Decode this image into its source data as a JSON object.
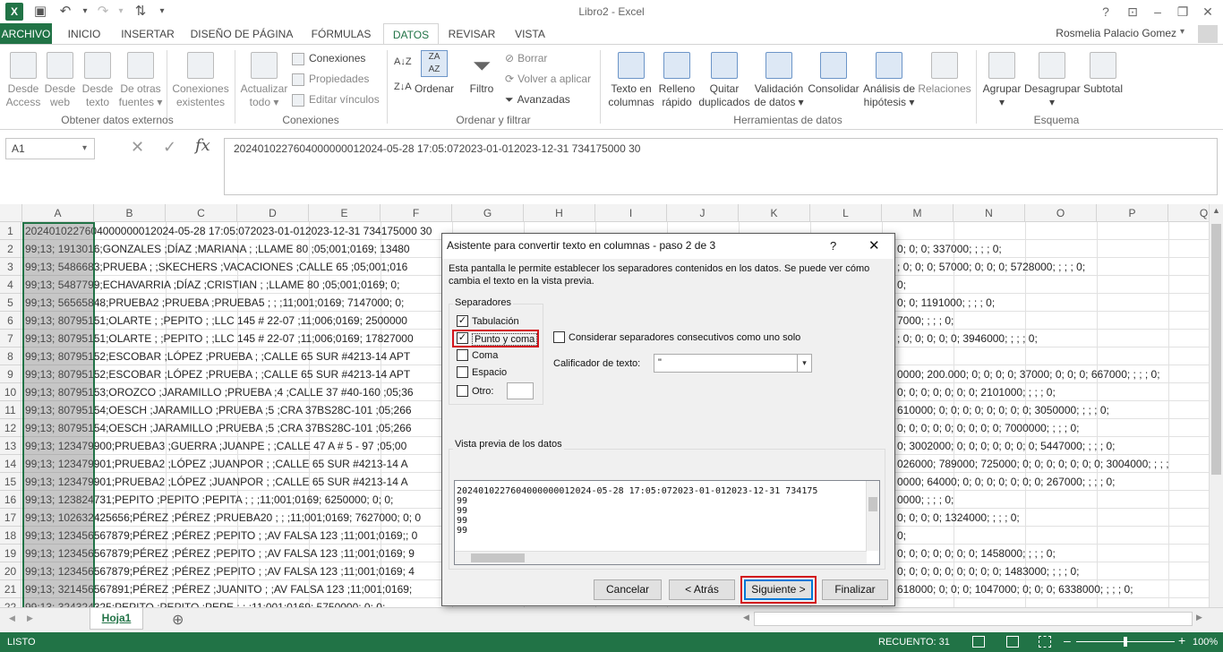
{
  "window": {
    "title": "Libro2 - Excel",
    "help": "?",
    "user": "Rosmelia Palacio Gomez",
    "sheet_tab": "Hoja1",
    "add_sheet": "⊕"
  },
  "tabs": [
    "ARCHIVO",
    "INICIO",
    "INSERTAR",
    "DISEÑO DE PÁGINA",
    "FÓRMULAS",
    "DATOS",
    "REVISAR",
    "VISTA"
  ],
  "ribbon": {
    "b0a": "Desde",
    "b0b": "Access",
    "b1a": "Desde",
    "b1b": "web",
    "b2a": "Desde",
    "b2b": "texto",
    "b3a": "De otras",
    "b3b": "fuentes ▾",
    "b4a": "Conexiones",
    "b4b": "existentes",
    "b5a": "Actualizar",
    "b5b": "todo ▾",
    "conexiones": "Conexiones",
    "propiedades": "Propiedades",
    "editar": "Editar vínculos",
    "ordenar": "Ordenar",
    "filtro": "Filtro",
    "borrar": "Borrar",
    "volver": "Volver a aplicar",
    "avanzadas": "Avanzadas",
    "b6a": "Texto en",
    "b6b": "columnas",
    "b7a": "Relleno",
    "b7b": "rápido",
    "b8a": "Quitar",
    "b8b": "duplicados",
    "b9a": "Validación",
    "b9b": "de datos ▾",
    "b10a": "Consolidar",
    "b11a": "Análisis de",
    "b11b": "hipótesis ▾",
    "b12a": "Relaciones",
    "b13a": "Agrupar",
    "b13b": "▾",
    "b14a": "Desagrupar",
    "b14b": "▾",
    "b15a": "Subtotal",
    "g1": "Obtener datos externos",
    "g2": "Conexiones",
    "g3": "Ordenar y filtrar",
    "g4": "Herramientas de datos",
    "g5": "Esquema"
  },
  "formula": {
    "namebox": "A1",
    "content": "20240102276040000000120​24-05-28 17:05:072023-01-012023-12-31 734175000 30"
  },
  "columns": [
    "A",
    "B",
    "C",
    "D",
    "E",
    "F",
    "G",
    "H",
    "I",
    "J",
    "K",
    "L",
    "M",
    "N",
    "O",
    "P",
    "Q"
  ],
  "rows": [
    {
      "n": "1",
      "t": "20240102276040000000120​24-05-28 17:05:072023-01-012023-12-31 734175000 30"
    },
    {
      "n": "2",
      "t": "99;13; 1913016;GONZALES ;DÍAZ ;MARIANA ; ;LLAME 80 ;05;001;0169; 13480"
    },
    {
      "n": "3",
      "t": "99;13; 5486683;PRUEBA ; ;SKECHERS ;VACACIONES ;CALLE 65 ;05;001;016"
    },
    {
      "n": "4",
      "t": "99;13; 5487799;ECHAVARRIA ;DÍAZ ;CRISTIAN ; ;LLAME 80 ;05;001;0169; 0;"
    },
    {
      "n": "5",
      "t": "99;13; 56565848;PRUEBA2 ;PRUEBA ;PRUEBA5 ; ; ;11;001;0169; 7147000; 0;"
    },
    {
      "n": "6",
      "t": "99;13; 80795151;OLARTE ; ;PEPITO ; ;LLC 145 # 22-07 ;11;006;0169; 2500000"
    },
    {
      "n": "7",
      "t": "99;13; 80795151;OLARTE ; ;PEPITO ; ;LLC 145 # 22-07 ;11;006;0169; 17827000"
    },
    {
      "n": "8",
      "t": "99;13; 80795152;ESCOBAR ;LÓPEZ ;PRUEBA ; ;CALLE 65 SUR #4213-14 APT"
    },
    {
      "n": "9",
      "t": "99;13; 80795152;ESCOBAR ;LÓPEZ ;PRUEBA ; ;CALLE 65 SUR #4213-14 APT"
    },
    {
      "n": "10",
      "t": "99;13; 80795153;OROZCO ;JARAMILLO ;PRUEBA ;4 ;CALLE 37 #40-160 ;05;36"
    },
    {
      "n": "11",
      "t": "99;13; 80795154;OESCH ;JARAMILLO ;PRUEBA ;5 ;CRA 37BS28C-101 ;05;266"
    },
    {
      "n": "12",
      "t": "99;13; 80795154;OESCH ;JARAMILLO ;PRUEBA ;5 ;CRA 37BS28C-101 ;05;266"
    },
    {
      "n": "13",
      "t": "99;13; 123479900;PRUEBA3 ;GUERRA ;JUANPE ; ;CALLE 47 A # 5 - 97 ;05;00"
    },
    {
      "n": "14",
      "t": "99;13; 123479901;PRUEBA2 ;LÓPEZ ;JUANPOR ; ;CALLE 65 SUR #4213-14 A"
    },
    {
      "n": "15",
      "t": "99;13; 123479901;PRUEBA2 ;LÓPEZ ;JUANPOR ; ;CALLE 65 SUR #4213-14 A"
    },
    {
      "n": "16",
      "t": "99;13; 123824731;PEPITO ;PEPITO ;PEPITA ; ; ;11;001;0169; 6250000; 0; 0;"
    },
    {
      "n": "17",
      "t": "99;13; 102632425656;PÉREZ ;PÉREZ ;PRUEBA20 ; ; ;11;001;0169; 7627000; 0; 0"
    },
    {
      "n": "18",
      "t": "99;13; 123456567879;PÉREZ ;PÉREZ ;PEPITO ; ;AV FALSA 123 ;11;001;0169;; 0"
    },
    {
      "n": "19",
      "t": "99;13; 123456567879;PÉREZ ;PÉREZ ;PEPITO ; ;AV FALSA 123 ;11;001;0169; 9"
    },
    {
      "n": "20",
      "t": "99;13; 123456567879;PÉREZ ;PÉREZ ;PEPITO ; ;AV FALSA 123 ;11;001;0169; 4"
    },
    {
      "n": "21",
      "t": "99;13; 321456567891;PÉREZ ;PÉREZ ;JUANITO ; ;AV FALSA 123 ;11;001;0169;"
    },
    {
      "n": "22",
      "t": "99;13; 324324325;PEPITO ;PEPITO ;PEPE ; ; ;11;001;0169; 5750000; 0; 0;"
    }
  ],
  "right_rows": [
    {
      "r": 2,
      "t": "0; 0; 0; 337000; ; ; ; 0;"
    },
    {
      "r": 3,
      "t": "; 0; 0; 0; 57000; 0; 0; 0; 5728000; ; ; ; 0;"
    },
    {
      "r": 4,
      "t": "0;"
    },
    {
      "r": 5,
      "t": "0; 0; 1191000; ; ; ; 0;"
    },
    {
      "r": 6,
      "t": "7000; ; ; ; 0;"
    },
    {
      "r": 7,
      "t": "; 0; 0; 0; 0; 0; 3946000; ; ; ; 0;"
    },
    {
      "r": 9,
      "t": "0000; 200.000; 0; 0; 0; 0; 37000; 0; 0; 0; 667000; ; ; ; 0;"
    },
    {
      "r": 10,
      "t": "0; 0; 0; 0; 0; 0; 0; 2101000; ; ; ; 0;"
    },
    {
      "r": 11,
      "t": "610000; 0; 0; 0; 0; 0; 0; 0; 0; 3050000; ; ; ; 0;"
    },
    {
      "r": 12,
      "t": "0; 0; 0; 0; 0; 0; 0; 0; 0; 7000000; ; ; ; 0;"
    },
    {
      "r": 13,
      "t": "0; 3002000; 0; 0; 0; 0; 0; 0; 0; 5447000; ; ; ; 0;"
    },
    {
      "r": 14,
      "t": "026000; 789000; 725000; 0; 0; 0; 0; 0; 0; 0; 3004000; ; ; ;"
    },
    {
      "r": 15,
      "t": "0000; 64000; 0; 0; 0; 0; 0; 0; 0; 267000; ; ; ; 0;"
    },
    {
      "r": 16,
      "t": "0000; ; ; ; 0;"
    },
    {
      "r": 17,
      "t": "0; 0; 0; 0; 1324000; ; ; ; 0;"
    },
    {
      "r": 18,
      "t": "0;"
    },
    {
      "r": 19,
      "t": "0; 0; 0; 0; 0; 0; 0; 1458000; ; ; ; 0;"
    },
    {
      "r": 20,
      "t": "0; 0; 0; 0; 0; 0; 0; 0; 0; 1483000; ; ; ; 0;"
    },
    {
      "r": 21,
      "t": "618000; 0; 0; 0; 1047000; 0; 0; 0; 6338000; ; ; ; 0;"
    }
  ],
  "dialog": {
    "title": "Asistente para convertir texto en columnas - paso 2 de 3",
    "help": "?",
    "desc1": "Esta pantalla le permite establecer los separadores contenidos en los datos. Se puede ver cómo",
    "desc2": "cambia el texto en la vista previa.",
    "separadores": "Separadores",
    "tab": "Tabulación",
    "punto": "Punto y coma",
    "coma": "Coma",
    "espacio": "Espacio",
    "otro": "Otro:",
    "consec": "Considerar separadores consecutivos como uno solo",
    "calif": "Calificador de texto:",
    "calif_val": "\"",
    "vista": "Vista previa de los datos",
    "preview_lines": [
      "20240102276040000000120​24-05-28 17:05:072023-01-012023-12-31 734175",
      "99",
      "99",
      "99",
      "99"
    ],
    "cancelar": "Cancelar",
    "atras": "< Atrás",
    "siguiente": "Siguiente >",
    "finalizar": "Finalizar"
  },
  "status": {
    "left": "LISTO",
    "recuento": "RECUENTO: 31",
    "zoom": "100%"
  },
  "colors": {
    "accent": "#217346",
    "highlight": "#d3141c"
  }
}
